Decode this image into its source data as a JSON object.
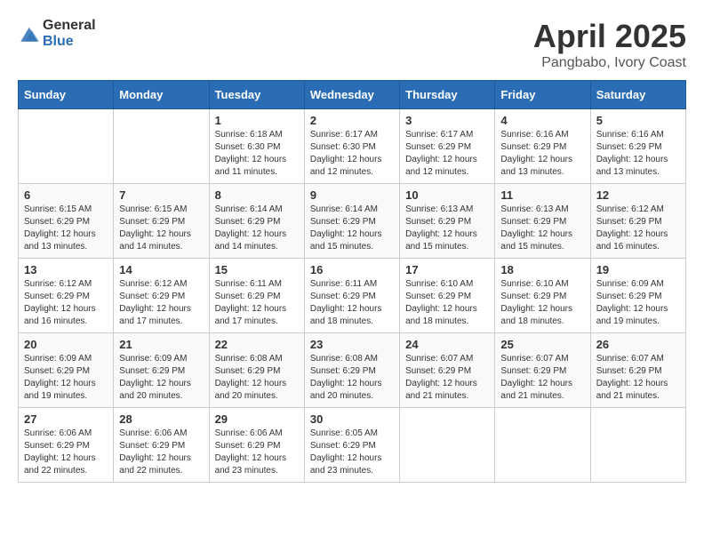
{
  "header": {
    "logo_general": "General",
    "logo_blue": "Blue",
    "title": "April 2025",
    "subtitle": "Pangbabo, Ivory Coast"
  },
  "days_of_week": [
    "Sunday",
    "Monday",
    "Tuesday",
    "Wednesday",
    "Thursday",
    "Friday",
    "Saturday"
  ],
  "weeks": [
    [
      {
        "day": "",
        "info": ""
      },
      {
        "day": "",
        "info": ""
      },
      {
        "day": "1",
        "info": "Sunrise: 6:18 AM\nSunset: 6:30 PM\nDaylight: 12 hours and 11 minutes."
      },
      {
        "day": "2",
        "info": "Sunrise: 6:17 AM\nSunset: 6:30 PM\nDaylight: 12 hours and 12 minutes."
      },
      {
        "day": "3",
        "info": "Sunrise: 6:17 AM\nSunset: 6:29 PM\nDaylight: 12 hours and 12 minutes."
      },
      {
        "day": "4",
        "info": "Sunrise: 6:16 AM\nSunset: 6:29 PM\nDaylight: 12 hours and 13 minutes."
      },
      {
        "day": "5",
        "info": "Sunrise: 6:16 AM\nSunset: 6:29 PM\nDaylight: 12 hours and 13 minutes."
      }
    ],
    [
      {
        "day": "6",
        "info": "Sunrise: 6:15 AM\nSunset: 6:29 PM\nDaylight: 12 hours and 13 minutes."
      },
      {
        "day": "7",
        "info": "Sunrise: 6:15 AM\nSunset: 6:29 PM\nDaylight: 12 hours and 14 minutes."
      },
      {
        "day": "8",
        "info": "Sunrise: 6:14 AM\nSunset: 6:29 PM\nDaylight: 12 hours and 14 minutes."
      },
      {
        "day": "9",
        "info": "Sunrise: 6:14 AM\nSunset: 6:29 PM\nDaylight: 12 hours and 15 minutes."
      },
      {
        "day": "10",
        "info": "Sunrise: 6:13 AM\nSunset: 6:29 PM\nDaylight: 12 hours and 15 minutes."
      },
      {
        "day": "11",
        "info": "Sunrise: 6:13 AM\nSunset: 6:29 PM\nDaylight: 12 hours and 15 minutes."
      },
      {
        "day": "12",
        "info": "Sunrise: 6:12 AM\nSunset: 6:29 PM\nDaylight: 12 hours and 16 minutes."
      }
    ],
    [
      {
        "day": "13",
        "info": "Sunrise: 6:12 AM\nSunset: 6:29 PM\nDaylight: 12 hours and 16 minutes."
      },
      {
        "day": "14",
        "info": "Sunrise: 6:12 AM\nSunset: 6:29 PM\nDaylight: 12 hours and 17 minutes."
      },
      {
        "day": "15",
        "info": "Sunrise: 6:11 AM\nSunset: 6:29 PM\nDaylight: 12 hours and 17 minutes."
      },
      {
        "day": "16",
        "info": "Sunrise: 6:11 AM\nSunset: 6:29 PM\nDaylight: 12 hours and 18 minutes."
      },
      {
        "day": "17",
        "info": "Sunrise: 6:10 AM\nSunset: 6:29 PM\nDaylight: 12 hours and 18 minutes."
      },
      {
        "day": "18",
        "info": "Sunrise: 6:10 AM\nSunset: 6:29 PM\nDaylight: 12 hours and 18 minutes."
      },
      {
        "day": "19",
        "info": "Sunrise: 6:09 AM\nSunset: 6:29 PM\nDaylight: 12 hours and 19 minutes."
      }
    ],
    [
      {
        "day": "20",
        "info": "Sunrise: 6:09 AM\nSunset: 6:29 PM\nDaylight: 12 hours and 19 minutes."
      },
      {
        "day": "21",
        "info": "Sunrise: 6:09 AM\nSunset: 6:29 PM\nDaylight: 12 hours and 20 minutes."
      },
      {
        "day": "22",
        "info": "Sunrise: 6:08 AM\nSunset: 6:29 PM\nDaylight: 12 hours and 20 minutes."
      },
      {
        "day": "23",
        "info": "Sunrise: 6:08 AM\nSunset: 6:29 PM\nDaylight: 12 hours and 20 minutes."
      },
      {
        "day": "24",
        "info": "Sunrise: 6:07 AM\nSunset: 6:29 PM\nDaylight: 12 hours and 21 minutes."
      },
      {
        "day": "25",
        "info": "Sunrise: 6:07 AM\nSunset: 6:29 PM\nDaylight: 12 hours and 21 minutes."
      },
      {
        "day": "26",
        "info": "Sunrise: 6:07 AM\nSunset: 6:29 PM\nDaylight: 12 hours and 21 minutes."
      }
    ],
    [
      {
        "day": "27",
        "info": "Sunrise: 6:06 AM\nSunset: 6:29 PM\nDaylight: 12 hours and 22 minutes."
      },
      {
        "day": "28",
        "info": "Sunrise: 6:06 AM\nSunset: 6:29 PM\nDaylight: 12 hours and 22 minutes."
      },
      {
        "day": "29",
        "info": "Sunrise: 6:06 AM\nSunset: 6:29 PM\nDaylight: 12 hours and 23 minutes."
      },
      {
        "day": "30",
        "info": "Sunrise: 6:05 AM\nSunset: 6:29 PM\nDaylight: 12 hours and 23 minutes."
      },
      {
        "day": "",
        "info": ""
      },
      {
        "day": "",
        "info": ""
      },
      {
        "day": "",
        "info": ""
      }
    ]
  ]
}
